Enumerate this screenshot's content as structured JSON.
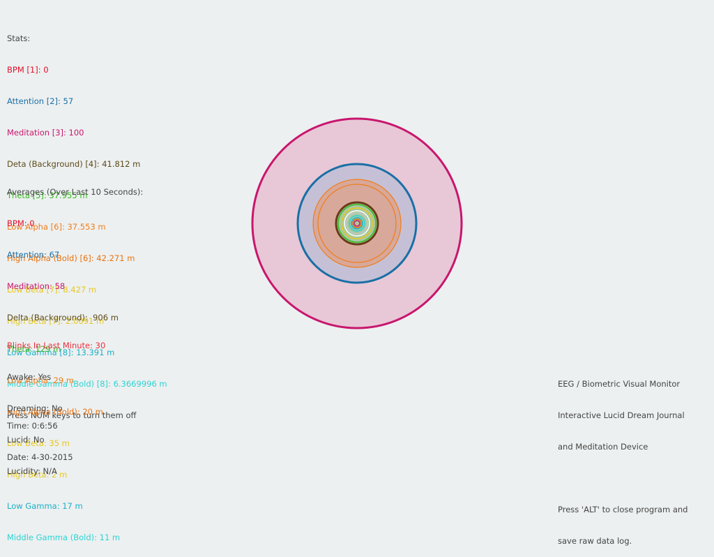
{
  "stats": {
    "header": "Stats:",
    "lines": [
      {
        "text": "BPM [1]: 0",
        "color": "#e0102a"
      },
      {
        "text": "Attention [2]: 57",
        "color": "#1a6fa6"
      },
      {
        "text": "Meditation [3]: 100",
        "color": "#c8166e"
      },
      {
        "text": "Deta (Background) [4]: 41.812 m",
        "color": "#5c4a1a"
      },
      {
        "text": "Theta [5]: 37.955 m",
        "color": "#34b81e"
      },
      {
        "text": "Low Alpha [6]: 37.553 m",
        "color": "#f07d1a"
      },
      {
        "text": "High Alpha (Bold) [6]: 42.271 m",
        "color": "#e8720e"
      },
      {
        "text": "Low Beta [7]: 8.427 m",
        "color": "#e6c81e"
      },
      {
        "text": "High Beta [7]: 2.0091 m",
        "color": "#e6c81e"
      },
      {
        "text": "Low Gamma [8]: 13.391 m",
        "color": "#1ab0c8"
      },
      {
        "text": "Middle Gamma (Bold) [8]: 6.3669996 m",
        "color": "#2ad4d4"
      }
    ],
    "footer": "Press NUM keys to turn them off"
  },
  "averages": {
    "header": "Averages (Over Last 10 Seconds):",
    "lines": [
      {
        "text": "BPM: 0",
        "color": "#e0102a"
      },
      {
        "text": "Attention: 67",
        "color": "#1a6fa6"
      },
      {
        "text": "Meditation: 58",
        "color": "#c8166e"
      },
      {
        "text": "Delta (Background):  906 m",
        "color": "#5c4a1a"
      },
      {
        "text": "Theta: 129 m",
        "color": "#34b81e"
      },
      {
        "text": "Low Alpha: 29 m",
        "color": "#f07d1a"
      },
      {
        "text": "High Alpha (Bold): 20 m",
        "color": "#e8720e"
      },
      {
        "text": "Low Beta: 35 m",
        "color": "#e6c81e"
      },
      {
        "text": "High Beta: 2 m",
        "color": "#e6c81e"
      },
      {
        "text": "Low Gamma: 17 m",
        "color": "#1ab0c8"
      },
      {
        "text": "Middle Gamma (Bold): 11 m",
        "color": "#2ad4d4"
      }
    ]
  },
  "status": {
    "blinks": {
      "text": "Blinks In Last Minute: 30",
      "color": "#e83040"
    },
    "awake": "Awake: Yes",
    "dreaming": "Dreaming: No",
    "lucid": "Lucid: No",
    "lucidity": "Lucidity: N/A"
  },
  "time": {
    "time": "Time: 0:6:56",
    "date": "Date: 4-30-2015"
  },
  "about": {
    "line1": "EEG / Biometric Visual Monitor",
    "line2": "Interactive Lucid Dream Journal",
    "line3": "and Meditation Device",
    "close1": "Press 'ALT' to close program and",
    "close2": "save raw data log."
  },
  "visual": {
    "meditation_ring": {
      "value": 100,
      "fill": "#e8c8d6",
      "stroke": "#c8166e"
    },
    "attention_ring": {
      "value": 57,
      "fill": "#c6c0d6",
      "stroke": "#1a6fa6"
    },
    "alpha_rings": {
      "stroke": "#f07d1a",
      "fill": "#d8a89a"
    },
    "theta_ring": {
      "stroke": "#6b3a1a",
      "fill": "#a8c8a0"
    },
    "inner_rings": [
      "#34b81e",
      "#e6c81e",
      "#ffffff",
      "#c8c8c8",
      "#2ad4d4",
      "#1ab0c8",
      "#e8720e",
      "#c8166e"
    ]
  }
}
